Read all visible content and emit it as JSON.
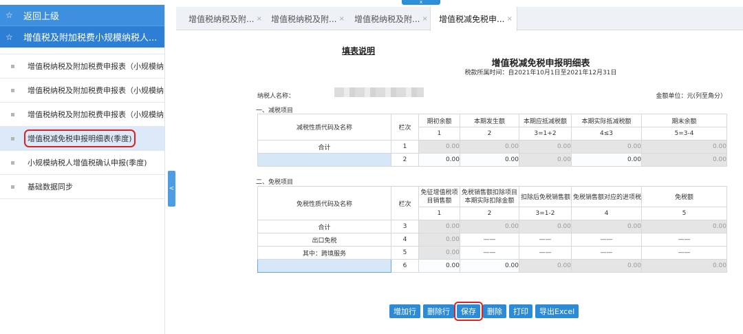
{
  "top_handle": "x",
  "sidebar": {
    "back_label": "返回上级",
    "section_label": "增值税及附加税费小规模纳税人...",
    "items": [
      {
        "label": "增值税纳税及附加税费申报表（小规模纳..."
      },
      {
        "label": "增值税纳税及附加税费申报表（小规模纳..."
      },
      {
        "label": "增值税纳税及附加税费申报表（小规模纳..."
      },
      {
        "label": "增值税减免税申报明细表(季度)"
      },
      {
        "label": "小规模纳税人增值税确认申报(季度)"
      },
      {
        "label": "基础数据同步"
      }
    ],
    "collapse_glyph": "<"
  },
  "tabs": [
    {
      "label": "增值税纳税及附...",
      "close": "×"
    },
    {
      "label": "增值税纳税及附...",
      "close": "×"
    },
    {
      "label": "增值税纳税及附...",
      "close": "×"
    },
    {
      "label": "增值税减免税申...",
      "close": "×"
    }
  ],
  "form": {
    "fill_note": "填表说明",
    "title": "增值税减免税申报明细表",
    "period": "税款所属时间：自2021年10月1日至2021年12月31日",
    "taxpayer_label": "纳税人名称：",
    "unit_label": "金额单位：元(列至角分）",
    "section1": "一、减税项目",
    "section2": "二、免税项目",
    "reduce_table": {
      "headers": {
        "name": "减税性质代码及名称",
        "line": "栏次",
        "c1": "期初余额",
        "c2": "本期发生额",
        "c3": "本期应抵减税额",
        "c4": "本期实际抵减税额",
        "c5": "期末余额"
      },
      "col_nums": [
        "1",
        "2",
        "3=1+2",
        "4≤3",
        "5=3-4"
      ],
      "rows": [
        {
          "name": "合计",
          "line": "1",
          "values": [
            "0.00",
            "0.00",
            "0.00",
            "0.00",
            "0.00"
          ]
        },
        {
          "name": "",
          "line": "2",
          "values": [
            "0.00",
            "0.00",
            "0.00",
            "0.00",
            "0.00"
          ]
        }
      ]
    },
    "exempt_table": {
      "headers": {
        "name": "免税性质代码及名称",
        "line": "栏次",
        "c1": "免征增值税项目销售额",
        "c2": "免税销售额扣除项目本期实际扣除金额",
        "c3": "扣除后免税销售额",
        "c4": "免税销售额对应的进项税额",
        "c5": "免税额"
      },
      "col_nums": [
        "1",
        "2",
        "3=1-2",
        "4",
        "5"
      ],
      "rows": [
        {
          "name": "合计",
          "line": "3",
          "values": [
            "0.00",
            "0.00",
            "0.00",
            "0.00",
            "0.00"
          ]
        },
        {
          "name": "出口免税",
          "line": "4",
          "values": [
            "0.00",
            "——",
            "——",
            "——",
            "——"
          ]
        },
        {
          "name": "其中：跨境服务",
          "line": "5",
          "values": [
            "0.00",
            "——",
            "——",
            "——",
            "——"
          ]
        },
        {
          "name": "",
          "line": "6",
          "values": [
            "0.00",
            "0.00",
            "0.00",
            "0.00",
            "0.00"
          ]
        }
      ]
    }
  },
  "buttons": {
    "add_row": "增加行",
    "delete_row": "删除行",
    "save": "保存",
    "delete": "删除",
    "print": "打印",
    "export": "导出Excel"
  }
}
